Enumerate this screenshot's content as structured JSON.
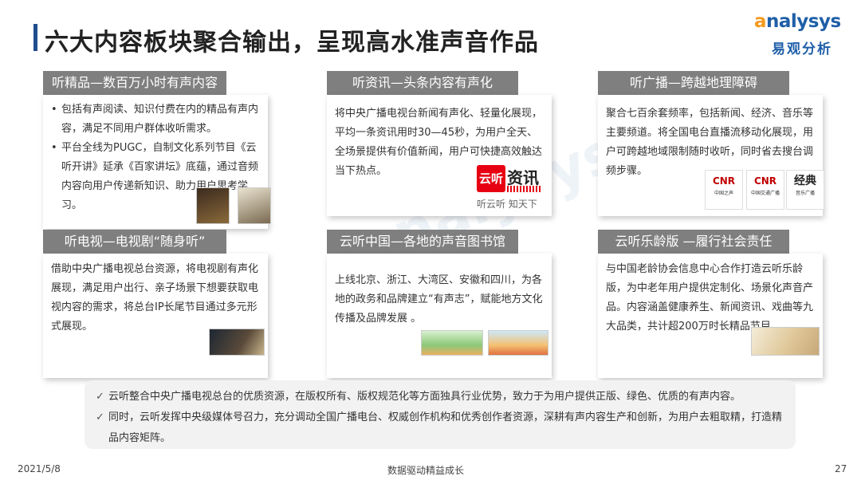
{
  "header": {
    "title": "六大内容板块聚合输出，呈现高水准声音作品",
    "logo_en_a": "a",
    "logo_en_rest": "nalysys",
    "logo_cn": "易观分析"
  },
  "panels": [
    {
      "title": "听精品—数百万小时有声内容",
      "bullets": [
        "包括有声阅读、知识付费在内的精品有声内容，满足不同用户群体收听需求。",
        "平台全线为PUGC，自制文化系列节目《云听开讲》延承《百家讲坛》底蕴，通过音频内容向用户传递新知识、助力用户思考学习。"
      ]
    },
    {
      "title": "听资讯—头条内容有声化",
      "text": "将中央广播电视台新闻有声化、轻量化展现，平均一条资讯用时30—45秒，为用户全天、全场景提供有价值新闻，用户可快捷高效触达当下热点。",
      "logo_box": "云听",
      "logo_side": "资讯",
      "logo_caption": "听云听 知天下"
    },
    {
      "title": "听广播—跨越地理障碍",
      "text": "聚合七百余套频率，包括新闻、经济、音乐等主要频道。将全国电台直播流移动化展现，用户可跨越地域限制随时收听，同时省去搜台调频步骤。",
      "station_logos": [
        {
          "big": "CNR",
          "small": "中国之声"
        },
        {
          "big": "CNR",
          "small": "中国交通广播"
        },
        {
          "big": "经典",
          "small": "音乐广播"
        }
      ]
    },
    {
      "title": "听电视—电视剧“随身听”",
      "text": "借助中央广播电视总台资源，将电视剧有声化展现，满足用户出行、亲子场景下想要获取电视内容的需求，将总台IP长尾节目通过多元形式展现。"
    },
    {
      "title": "云听中国—各地的声音图书馆",
      "text": "上线北京、浙江、大湾区、安徽和四川，为各地的政务和品牌建立“有声志”，赋能地方文化传播及品牌发展 。"
    },
    {
      "title": "云听乐龄版 —履行社会责任",
      "text": "与中国老龄协会信息中心合作打造云听乐龄版，为中老年用户提供定制化、场景化声音产品。内容涵盖健康养生、新闻资讯、戏曲等九大品类，共计超200万时长精品节目。"
    }
  ],
  "summary": [
    "云听整合中央广播电视总台的优质资源，在版权所有、版权规范化等方面独具行业优势，致力于为用户提供正版、绿色、优质的有声内容。",
    "同时，云听发挥中央级媒体号召力，充分调动全国广播电台、权威创作机构和优秀创作者资源，深耕有声内容生产和创新，为用户去粗取精，打造精品内容矩阵。"
  ],
  "summary_mark": "✓",
  "footer": {
    "date": "2021/5/8",
    "slogan": "数据驱动精益成长",
    "page": "27"
  }
}
